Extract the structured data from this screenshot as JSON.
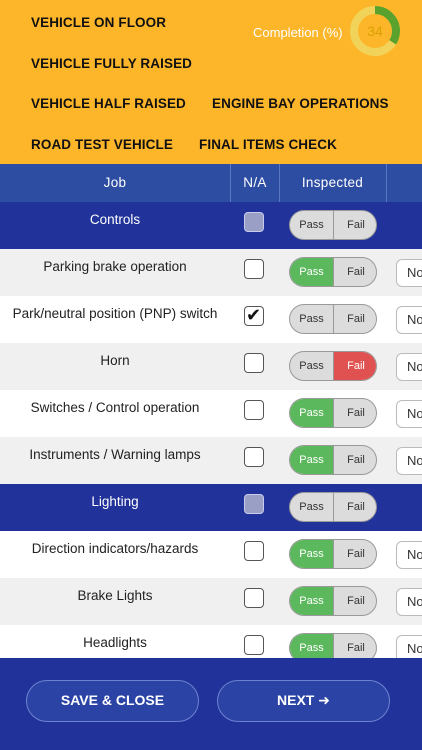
{
  "header": {
    "tabs": [
      {
        "label": "VEHICLE ON FLOOR",
        "active": true
      },
      {
        "label": "VEHICLE FULLY RAISED",
        "active": false
      },
      {
        "label": "VEHICLE HALF RAISED",
        "active": false
      },
      {
        "label": "ENGINE BAY OPERATIONS",
        "active": false
      },
      {
        "label": "ROAD TEST VEHICLE",
        "active": false
      },
      {
        "label": "FINAL ITEMS CHECK",
        "active": false
      }
    ],
    "completion_label": "Completion (%)",
    "completion_value": "34",
    "completion_fraction": 0.34,
    "colors": {
      "background": "#fdb52a",
      "active_tab": "#e8401c",
      "donut_ring": "#f2d35a",
      "donut_progress": "#5aa12e"
    }
  },
  "table": {
    "headers": {
      "job": "Job",
      "na": "N/A",
      "inspected": "Inspected"
    },
    "pass_label": "Pass",
    "fail_label": "Fail",
    "no_label": "No",
    "rows": [
      {
        "type": "section",
        "label": "Controls",
        "na": false,
        "result": "none"
      },
      {
        "type": "item",
        "label": "Parking brake operation",
        "na": false,
        "result": "pass"
      },
      {
        "type": "item",
        "label": "Park/neutral position (PNP) switch",
        "na": true,
        "result": "none"
      },
      {
        "type": "item",
        "label": "Horn",
        "na": false,
        "result": "fail"
      },
      {
        "type": "item",
        "label": "Switches / Control operation",
        "na": false,
        "result": "pass"
      },
      {
        "type": "item",
        "label": "Instruments / Warning lamps",
        "na": false,
        "result": "pass"
      },
      {
        "type": "section",
        "label": "Lighting",
        "na": false,
        "result": "none"
      },
      {
        "type": "item",
        "label": "Direction indicators/hazards",
        "na": false,
        "result": "pass"
      },
      {
        "type": "item",
        "label": "Brake Lights",
        "na": false,
        "result": "pass"
      },
      {
        "type": "item",
        "label": "Headlights",
        "na": false,
        "result": "pass"
      }
    ]
  },
  "footer": {
    "save_close": "SAVE & CLOSE",
    "next": "NEXT ➜"
  }
}
